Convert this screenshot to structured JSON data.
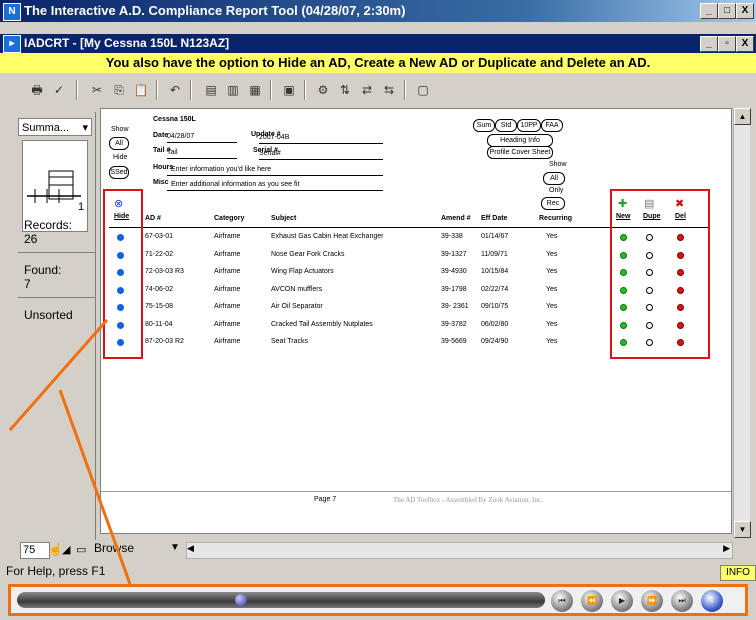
{
  "window": {
    "title": "The Interactive A.D. Compliance Report Tool (04/28/07, 2:30m)",
    "controls": [
      "_",
      "□",
      "X"
    ]
  },
  "document_window": {
    "title": "IADCRT - [My Cessna 150L N123AZ]",
    "controls": [
      "_",
      "▫",
      "X"
    ]
  },
  "banner": "You also have the option to Hide an AD, Create a New AD or Duplicate and Delete an AD.",
  "left_panel": {
    "layout": "Summa...",
    "record_num": "1",
    "records_label": "Records:",
    "records_value": "26",
    "found_label": "Found:",
    "found_value": "7",
    "sort_status": "Unsorted"
  },
  "report": {
    "aircraft": "Cessna 150L",
    "show_label": "Show",
    "all_label": "All",
    "hide_label": "Hide",
    "ssed_label": "SSed",
    "date_label": "Date",
    "date_value": "04/28/07",
    "update_label": "Update #",
    "update_value": "2007-04B",
    "tail_label": "Tail #",
    "tail_value": "Tail",
    "serial_label": "Serial #",
    "serial_value": "Serial#",
    "hours_label": "Hours",
    "hours_value": "Enter information you'd like here",
    "misc_label": "Misc",
    "misc_value": "Enter additional information as you see fit",
    "right_buttons": [
      "Sum",
      "Std",
      "10PP",
      "FAA"
    ],
    "heading_info": "Heading Info",
    "profile_cover": "Profile Cover Sheet",
    "show2": "Show",
    "all2": "All",
    "only_label": "Only",
    "rec_label": "Rec",
    "hide_col": "Hide",
    "actions": [
      "New",
      "Dupe",
      "Del"
    ],
    "columns": [
      "AD #",
      "Category",
      "Subject",
      "Amend #",
      "Eff Date",
      "Recurring"
    ],
    "rows": [
      {
        "ad": "67-03-01",
        "category": "Airframe",
        "subject": "Exhaust Gas Cabin Heat Exchanger",
        "amend": "39-338",
        "eff": "01/14/67",
        "recurring": "Yes"
      },
      {
        "ad": "71-22-02",
        "category": "Airframe",
        "subject": "Nose Gear Fork Cracks",
        "amend": "39-1327",
        "eff": "11/09/71",
        "recurring": "Yes"
      },
      {
        "ad": "72-03-03 R3",
        "category": "Airframe",
        "subject": "Wing Flap Actuators",
        "amend": "39-4930",
        "eff": "10/15/84",
        "recurring": "Yes"
      },
      {
        "ad": "74-06-02",
        "category": "Airframe",
        "subject": "AVCON mufflers",
        "amend": "39-1798",
        "eff": "02/22/74",
        "recurring": "Yes"
      },
      {
        "ad": "75-15-08",
        "category": "Airframe",
        "subject": "Air Oil Separator",
        "amend": "39- 2361",
        "eff": "09/10/75",
        "recurring": "Yes"
      },
      {
        "ad": "80-11-04",
        "category": "Airframe",
        "subject": "Cracked Tail Assembly Nutplates",
        "amend": "39-3782",
        "eff": "06/02/80",
        "recurring": "Yes"
      },
      {
        "ad": "87-20-03 R2",
        "category": "Airframe",
        "subject": "Seat Tracks",
        "amend": "39-5669",
        "eff": "09/24/90",
        "recurring": "Yes"
      }
    ],
    "footer_page": "Page 7",
    "footer_credit": "The AD Toolbox - Assembled By Zook Aviation, Inc."
  },
  "mode_bar": {
    "zoom": "75",
    "mode": "Browse"
  },
  "status_bar": {
    "help_text": "For Help, press F1",
    "info": "INFO"
  },
  "colors": {
    "highlight_box": "#e0101a",
    "callout": "#f07010",
    "banner": "#ffff66"
  }
}
